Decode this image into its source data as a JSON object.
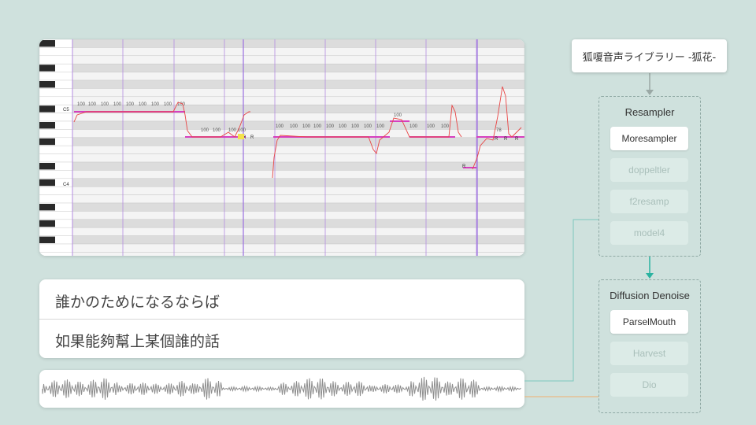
{
  "piano_roll": {
    "octave_labels": [
      "C5",
      "C4"
    ],
    "note_velocity": "100",
    "note_velocity_alt": "78",
    "rest_label": "R"
  },
  "lyrics": {
    "japanese": "誰かのためになるならば",
    "chinese": "如果能夠幫上某個誰的話"
  },
  "voicebank": {
    "name": "狐嗄音声ライブラリー -狐花-"
  },
  "resampler": {
    "title": "Resampler",
    "options": [
      {
        "label": "Moresampler",
        "selected": true
      },
      {
        "label": "doppeltler",
        "selected": false
      },
      {
        "label": "f2resamp",
        "selected": false
      },
      {
        "label": "model4",
        "selected": false
      }
    ]
  },
  "denoise": {
    "title": "Diffusion Denoise",
    "options": [
      {
        "label": "ParselMouth",
        "selected": true
      },
      {
        "label": "Harvest",
        "selected": false
      },
      {
        "label": "Dio",
        "selected": false
      }
    ]
  },
  "colors": {
    "background": "#cfe1dd",
    "arrow_gray": "#9aa8a5",
    "arrow_teal": "#2ab3a0",
    "connector_teal": "#7cc8bd",
    "connector_orange": "#f0b070",
    "note_color": "#d63fbf",
    "pitch_curve": "#e84545",
    "bar_line": "#b38be0"
  }
}
